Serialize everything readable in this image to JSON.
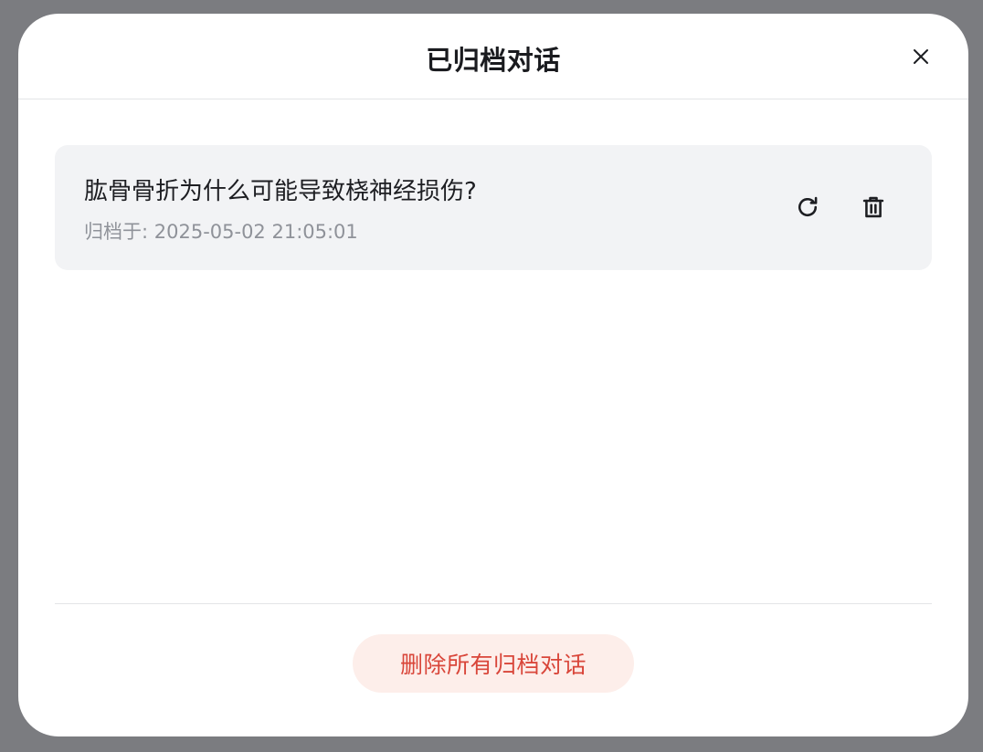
{
  "dialog": {
    "title": "已归档对话",
    "close_icon": "close-icon"
  },
  "archived_items": [
    {
      "title": "肱骨骨折为什么可能导致桡神经损伤?",
      "archived_at": "归档于: 2025-05-02 21:05:01",
      "restore_icon": "restore-icon",
      "delete_icon": "trash-icon"
    }
  ],
  "footer": {
    "delete_all_label": "删除所有归档对话"
  },
  "colors": {
    "overlay": "#7b7c80",
    "item_background": "#f2f3f5",
    "danger_text": "#d9463a",
    "danger_background": "#fdeeea"
  }
}
